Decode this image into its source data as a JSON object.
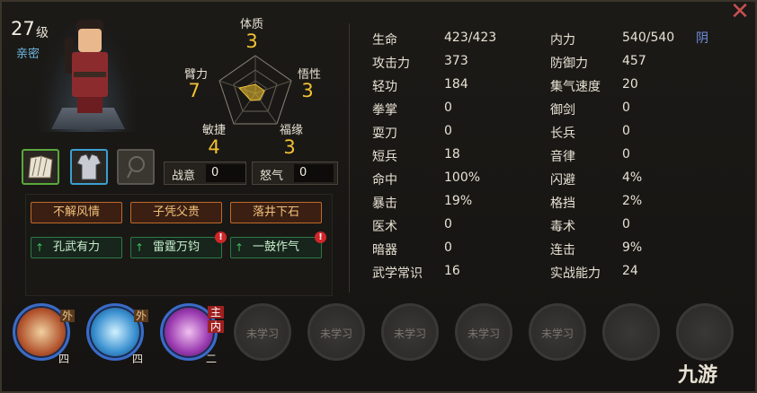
{
  "character": {
    "level": "27",
    "level_unit": "级",
    "relation": "亲密"
  },
  "radar": {
    "attributes": [
      {
        "label": "体质",
        "value": "3"
      },
      {
        "label": "悟性",
        "value": "3"
      },
      {
        "label": "福缘",
        "value": "3"
      },
      {
        "label": "敏捷",
        "value": "4"
      },
      {
        "label": "臂力",
        "value": "7"
      }
    ]
  },
  "boxes": {
    "morale_label": "战意",
    "morale_value": "0",
    "rage_label": "怒气",
    "rage_value": "0"
  },
  "traits": {
    "orange": [
      "不解风情",
      "子凭父贵",
      "落井下石"
    ],
    "green": [
      "孔武有力",
      "雷霆万钧",
      "一鼓作气"
    ]
  },
  "stats_left": [
    {
      "label": "生命",
      "value": "423/423"
    },
    {
      "label": "攻击力",
      "value": "373"
    },
    {
      "label": "轻功",
      "value": "184"
    },
    {
      "label": "拳掌",
      "value": "0"
    },
    {
      "label": "耍刀",
      "value": "0"
    },
    {
      "label": "短兵",
      "value": "18"
    },
    {
      "label": "命中",
      "value": "100%"
    },
    {
      "label": "暴击",
      "value": "19%"
    },
    {
      "label": "医术",
      "value": "0"
    },
    {
      "label": "暗器",
      "value": "0"
    },
    {
      "label": "武学常识",
      "value": "16"
    }
  ],
  "stats_right": [
    {
      "label": "内力",
      "value": "540/540"
    },
    {
      "label": "防御力",
      "value": "457"
    },
    {
      "label": "集气速度",
      "value": "20"
    },
    {
      "label": "御剑",
      "value": "0"
    },
    {
      "label": "长兵",
      "value": "0"
    },
    {
      "label": "音律",
      "value": "0"
    },
    {
      "label": "闪避",
      "value": "4%"
    },
    {
      "label": "格挡",
      "value": "2%"
    },
    {
      "label": "毒术",
      "value": "0"
    },
    {
      "label": "连击",
      "value": "9%"
    },
    {
      "label": "实战能力",
      "value": "24"
    }
  ],
  "alignment": "阴",
  "close_icon": "✕",
  "skills": [
    {
      "tag": "外",
      "level": "四"
    },
    {
      "tag": "外",
      "level": "四"
    },
    {
      "tag_main": "主",
      "tag_inner": "内",
      "level": "二"
    }
  ],
  "empty_skill_label": "未学习",
  "watermark": "九游",
  "colors": {
    "gold": "#f1c232",
    "blue": "#6fb7e0",
    "orange_border": "#c06a2a",
    "green_border": "#2d7a45",
    "badge": "#d0262a"
  }
}
